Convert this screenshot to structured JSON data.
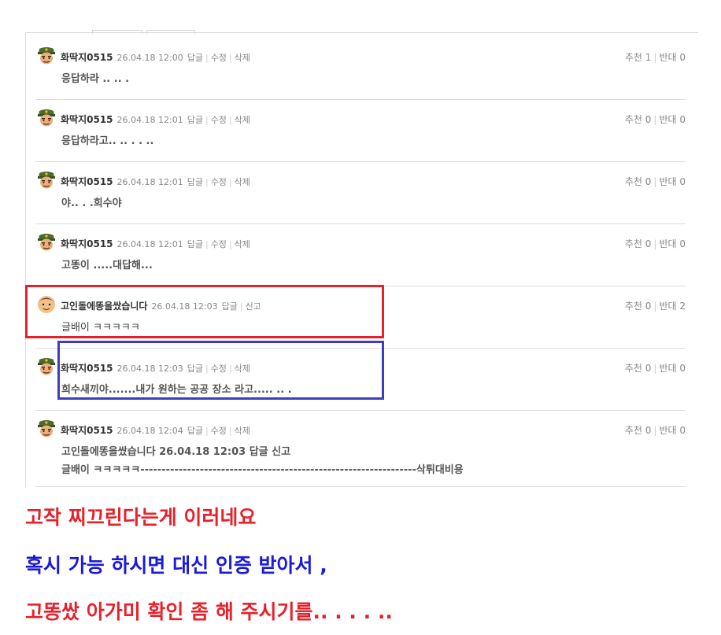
{
  "comments": [
    {
      "author": "화딱지0515",
      "date": "26.04.18 12:00",
      "actions": [
        "답글",
        "수정",
        "삭제"
      ],
      "text": "응답하라 .. .. .",
      "text2": "",
      "up_label": "추천 1",
      "down_label": "반대 0",
      "avatar": "soldier-avatar-icon"
    },
    {
      "author": "화딱지0515",
      "date": "26.04.18 12:01",
      "actions": [
        "답글",
        "수정",
        "삭제"
      ],
      "text": "응답하라고.. .. . . ..",
      "text2": "",
      "up_label": "추천 0",
      "down_label": "반대 0",
      "avatar": "soldier-avatar-icon"
    },
    {
      "author": "화딱지0515",
      "date": "26.04.18 12:01",
      "actions": [
        "답글",
        "수정",
        "삭제"
      ],
      "text": "야.. . .희수야",
      "text2": "",
      "up_label": "추천 0",
      "down_label": "반대 0",
      "avatar": "soldier-avatar-icon"
    },
    {
      "author": "화딱지0515",
      "date": "26.04.18 12:01",
      "actions": [
        "답글",
        "수정",
        "삭제"
      ],
      "text": "고똥이 .....대답해...",
      "text2": "",
      "up_label": "추천 0",
      "down_label": "반대 0",
      "avatar": "soldier-avatar-icon"
    },
    {
      "author": "고인돌에똥을쌌습니다",
      "date": "26.04.18 12:03",
      "actions": [
        "답글",
        "신고"
      ],
      "text": "글배이 ㅋㅋㅋㅋㅋ",
      "text2": "",
      "up_label": "추천 0",
      "down_label": "반대 2",
      "avatar": "face-avatar-icon"
    },
    {
      "author": "화딱지0515",
      "date": "26.04.18 12:03",
      "actions": [
        "답글",
        "수정",
        "삭제"
      ],
      "text": "희수새끼야.......내가 원하는 공공 장소 라고..... .. .",
      "text2": "",
      "up_label": "추천 0",
      "down_label": "반대 0",
      "avatar": "soldier-avatar-icon"
    },
    {
      "author": "화딱지0515",
      "date": "26.04.18 12:04",
      "actions": [
        "답글",
        "수정",
        "삭제"
      ],
      "text": "고인돌에똥을쌌습니다 26.04.18 12:03 답글 신고",
      "text2": "글배이 ㅋㅋㅋㅋㅋ-----------------------------------------------------------------삭튀대비용",
      "up_label": "추천 0",
      "down_label": "반대 0",
      "avatar": "soldier-avatar-icon"
    }
  ],
  "captions": {
    "line1": "고작 찌끄린다는게 이러네요",
    "line2": "혹시 가능 하시면 대신 인증 받아서 ,",
    "line3": "고똥쌌 아가미 확인 좀 해 주시기를.. . . . .."
  },
  "colors": {
    "red": "#e8202a",
    "blue": "#1a1ad8",
    "box_blue": "#3d3dbf"
  }
}
